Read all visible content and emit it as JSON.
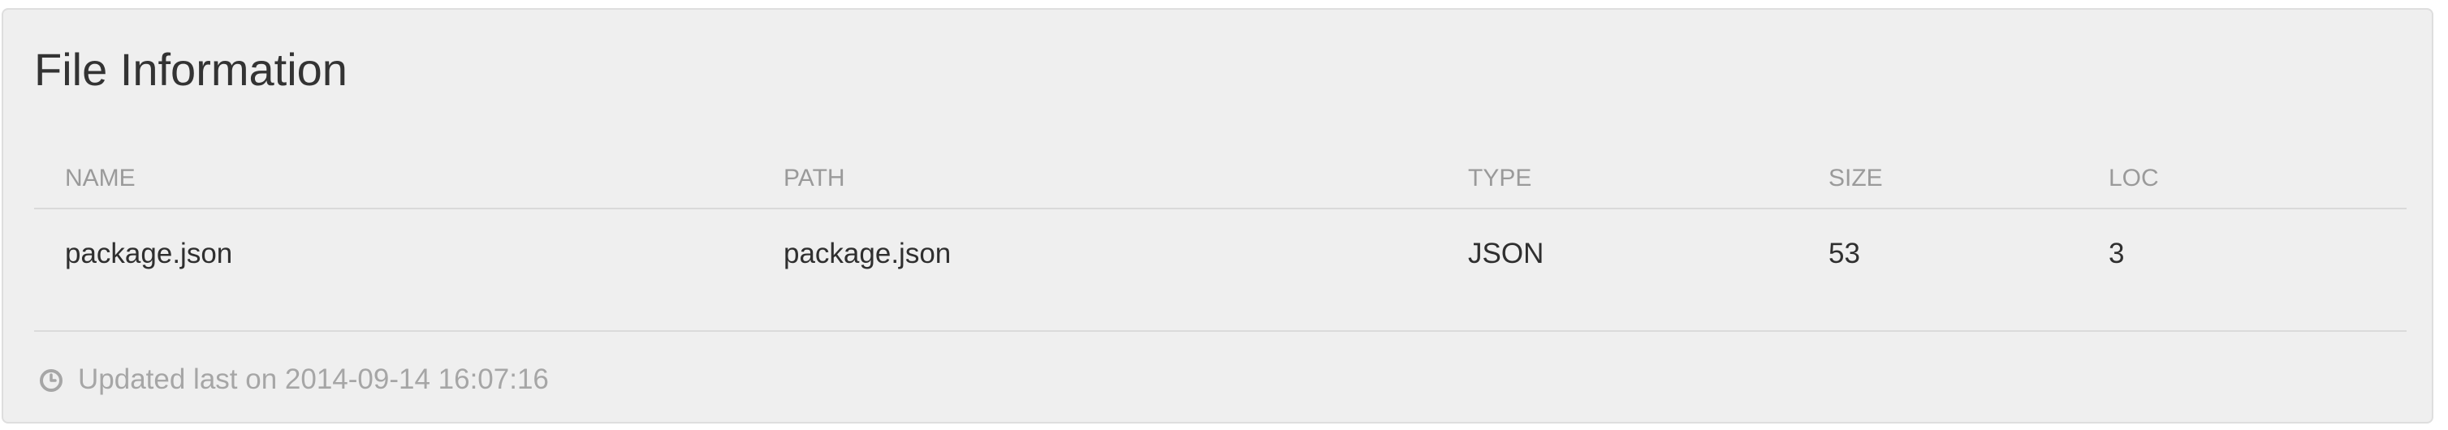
{
  "card": {
    "title": "File Information"
  },
  "table": {
    "columns": [
      "NAME",
      "PATH",
      "TYPE",
      "SIZE",
      "LOC"
    ],
    "rows": [
      [
        "package.json",
        "package.json",
        "JSON",
        "53",
        "3"
      ]
    ]
  },
  "footer": {
    "icon": "clock-icon",
    "text": "Updated last on 2014-09-14 16:07:16"
  }
}
